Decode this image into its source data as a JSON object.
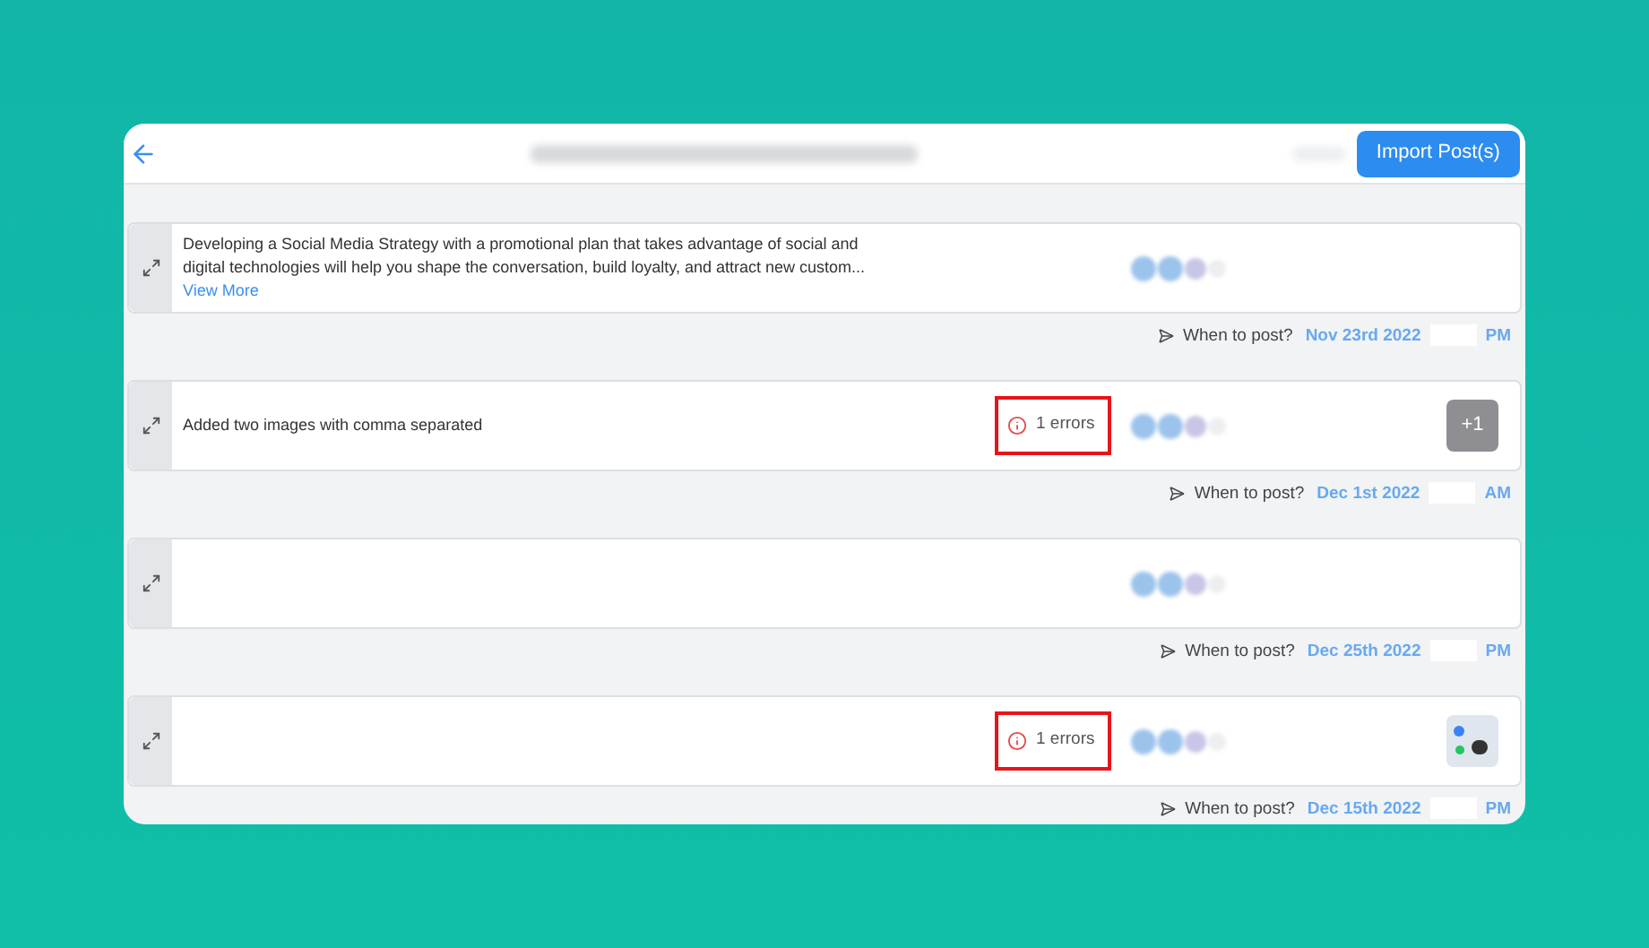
{
  "header": {
    "action_button": "Import Post(s)"
  },
  "posts": [
    {
      "text": "Developing a Social Media Strategy with a promotional plan that takes advantage of social and digital technologies will help you shape the conversation, build loyalty, and attract new custom...",
      "link": "View More",
      "media": {
        "kind": "none"
      },
      "schedule": {
        "label": "When to post?",
        "date": "Nov 23rd 2022",
        "period": "PM"
      }
    },
    {
      "text": "Added two images with comma separated",
      "errors": "1 errors",
      "media": {
        "kind": "more",
        "label": "+1"
      },
      "schedule": {
        "label": "When to post?",
        "date": "Dec 1st 2022",
        "period": "AM"
      }
    },
    {
      "media": {
        "kind": "none"
      },
      "schedule": {
        "label": "When to post?",
        "date": "Dec 25th 2022",
        "period": "PM"
      }
    },
    {
      "errors": "1 errors",
      "media": {
        "kind": "thumbnail"
      },
      "schedule": {
        "label": "When to post?",
        "date": "Dec 15th 2022",
        "period": "PM"
      }
    }
  ]
}
